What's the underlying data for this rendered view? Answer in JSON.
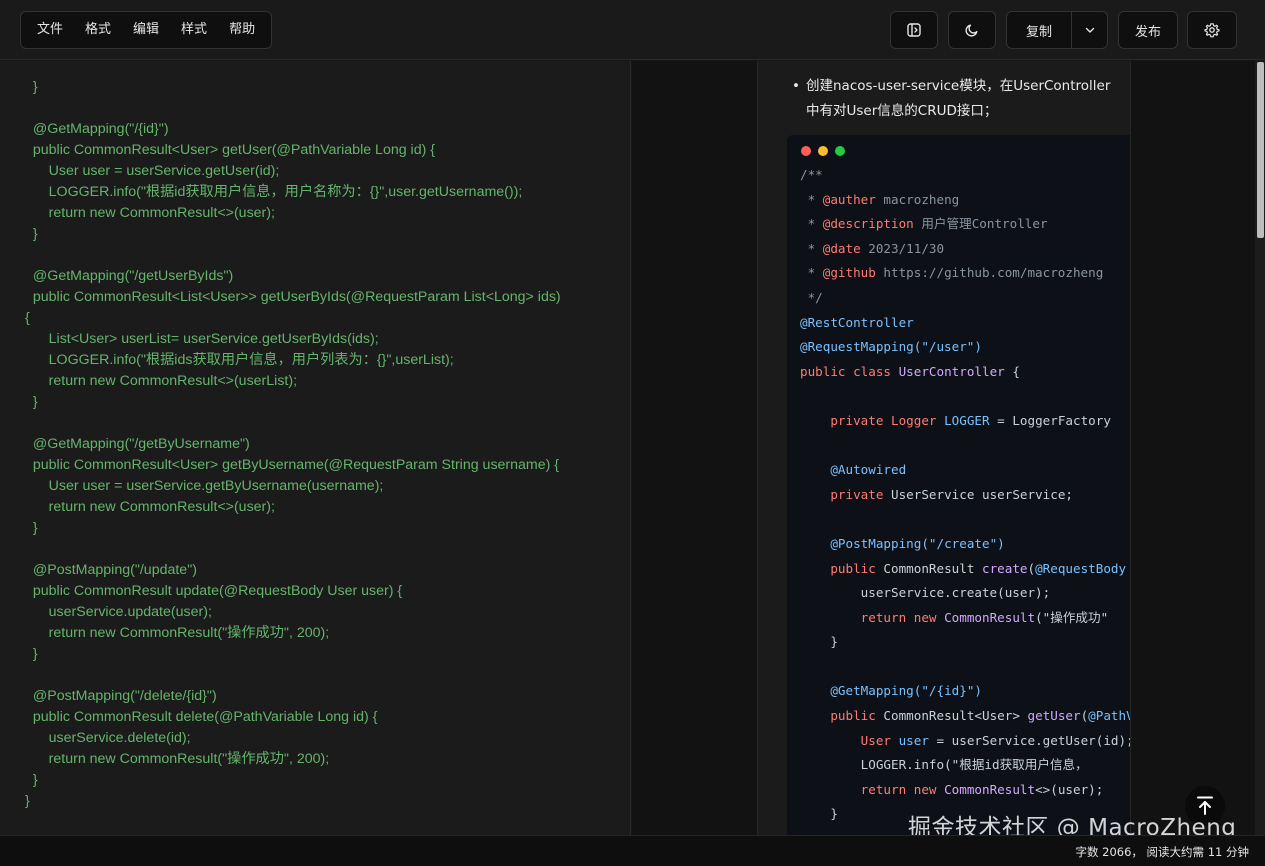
{
  "menu": [
    "文件",
    "格式",
    "编辑",
    "样式",
    "帮助"
  ],
  "toolbar": {
    "layout_icon": "sidebar-panel-icon",
    "theme_icon": "moon-icon",
    "copy_label": "复制",
    "copy_arrow_icon": "chevron-down-icon",
    "publish_label": "发布",
    "settings_icon": "gear-icon"
  },
  "editor": {
    "code": "  }\n\n  @GetMapping(\"/{id}\")\n  public CommonResult<User> getUser(@PathVariable Long id) {\n      User user = userService.getUser(id);\n      LOGGER.info(\"根据id获取用户信息，用户名称为：{}\",user.getUsername());\n      return new CommonResult<>(user);\n  }\n\n  @GetMapping(\"/getUserByIds\")\n  public CommonResult<List<User>> getUserByIds(@RequestParam List<Long> ids)\n{\n      List<User> userList= userService.getUserByIds(ids);\n      LOGGER.info(\"根据ids获取用户信息，用户列表为：{}\",userList);\n      return new CommonResult<>(userList);\n  }\n\n  @GetMapping(\"/getByUsername\")\n  public CommonResult<User> getByUsername(@RequestParam String username) {\n      User user = userService.getByUsername(username);\n      return new CommonResult<>(user);\n  }\n\n  @PostMapping(\"/update\")\n  public CommonResult update(@RequestBody User user) {\n      userService.update(user);\n      return new CommonResult(\"操作成功\", 200);\n  }\n\n  @PostMapping(\"/delete/{id}\")\n  public CommonResult delete(@PathVariable Long id) {\n      userService.delete(id);\n      return new CommonResult(\"操作成功\", 200);\n  }\n}"
  },
  "preview": {
    "bullet": "创建nacos-user-service模块，在UserController中有对User信息的CRUD接口；",
    "lights": [
      "#ff5f56",
      "#ffbd2e",
      "#27c93f"
    ],
    "code_lines": [
      [
        [
          "cm",
          "/**"
        ]
      ],
      [
        [
          "cm",
          " * "
        ],
        [
          "tg",
          "@auther"
        ],
        [
          "cm",
          " macrozheng"
        ]
      ],
      [
        [
          "cm",
          " * "
        ],
        [
          "tg",
          "@description"
        ],
        [
          "cm",
          " 用户管理Controller"
        ]
      ],
      [
        [
          "cm",
          " * "
        ],
        [
          "tg",
          "@date"
        ],
        [
          "cm",
          " 2023/11/30"
        ]
      ],
      [
        [
          "cm",
          " * "
        ],
        [
          "tg",
          "@github"
        ],
        [
          "cm",
          " https://github.com/macrozheng"
        ]
      ],
      [
        [
          "cm",
          " */"
        ]
      ],
      [
        [
          "an",
          "@RestController"
        ]
      ],
      [
        [
          "an",
          "@RequestMapping(\"/user\")"
        ]
      ],
      [
        [
          "kw",
          "public class "
        ],
        [
          "cl",
          "UserController"
        ],
        [
          "",
          " {"
        ]
      ],
      [],
      [
        [
          "",
          "    "
        ],
        [
          "kw",
          "private "
        ],
        [
          "tg",
          "Logger "
        ],
        [
          "nm",
          "LOGGER"
        ],
        [
          "",
          " = LoggerFactory"
        ]
      ],
      [],
      [
        [
          "",
          "    "
        ],
        [
          "an",
          "@Autowired"
        ]
      ],
      [
        [
          "",
          "    "
        ],
        [
          "kw",
          "private "
        ],
        [
          "",
          "UserService userService;"
        ]
      ],
      [],
      [
        [
          "",
          "    "
        ],
        [
          "an",
          "@PostMapping(\"/create\")"
        ]
      ],
      [
        [
          "",
          "    "
        ],
        [
          "kw",
          "public "
        ],
        [
          "",
          "CommonResult "
        ],
        [
          "cl",
          "create"
        ],
        [
          "",
          "("
        ],
        [
          "an",
          "@RequestBody"
        ]
      ],
      [
        [
          "",
          "        userService.create(user);"
        ]
      ],
      [
        [
          "",
          "        "
        ],
        [
          "kw",
          "return new "
        ],
        [
          "cl",
          "CommonResult"
        ],
        [
          "",
          "(\"操作成功\""
        ]
      ],
      [
        [
          "",
          "    }"
        ]
      ],
      [],
      [
        [
          "",
          "    "
        ],
        [
          "an",
          "@GetMapping(\"/{id}\")"
        ]
      ],
      [
        [
          "",
          "    "
        ],
        [
          "kw",
          "public "
        ],
        [
          "",
          "CommonResult<User> "
        ],
        [
          "cl",
          "getUser"
        ],
        [
          "",
          "("
        ],
        [
          "an",
          "@PathVariable"
        ]
      ],
      [
        [
          "",
          "        "
        ],
        [
          "tg",
          "User "
        ],
        [
          "nm",
          "user"
        ],
        [
          "",
          " = userService.getUser(id);"
        ]
      ],
      [
        [
          "",
          "        LOGGER.info(\"根据id获取用户信息，"
        ]
      ],
      [
        [
          "",
          "        "
        ],
        [
          "kw",
          "return new "
        ],
        [
          "cl",
          "CommonResult"
        ],
        [
          "",
          "<>(user);"
        ]
      ],
      [
        [
          "",
          "    }"
        ]
      ]
    ]
  },
  "watermark": "掘金技术社区 @ MacroZheng",
  "back_to_top_icon": "arrow-up-icon",
  "status": "字数 2066， 阅读大约需 11 分钟"
}
